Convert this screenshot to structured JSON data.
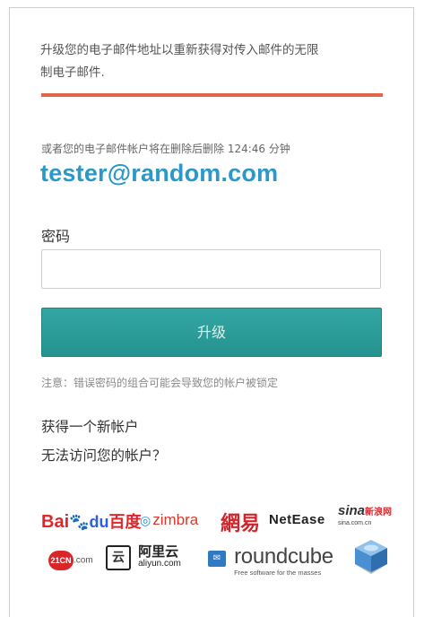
{
  "notice": {
    "line1": "升级您的电子邮件地址以重新获得对传入邮件的无限",
    "line2": "制电子邮件."
  },
  "deletion_text": "或者您的电子邮件帐户将在删除后删除 124:46 分钟",
  "email": "tester@random.com",
  "password": {
    "label": "密码",
    "value": "",
    "placeholder": ""
  },
  "upgrade_button": "升级",
  "warning": "注意：错误密码的组合可能会导致您的帐户被锁定",
  "links": {
    "new_account": "获得一个新帐户",
    "cant_access": "无法访问您的帐户？"
  },
  "logos": {
    "baidu": {
      "bai": "Bai",
      "du": "du",
      "cn": "百度"
    },
    "zimbra": "zimbra",
    "wangyi": "網易",
    "netease": "NetEase",
    "sina": {
      "main": "sina",
      "cn": "新浪网",
      "domain": "sina.com.cn"
    },
    "c21": {
      "ball": "21CN",
      "com": ".com"
    },
    "aliyun": {
      "cn": "阿里云",
      "en": "aliyun.com"
    },
    "roundcube": {
      "name": "roundcube",
      "tagline": "Free software for the masses"
    }
  },
  "colors": {
    "accent_red": "#e0654b",
    "email_blue": "#2a98c9",
    "button_teal": "#2a9c98"
  }
}
